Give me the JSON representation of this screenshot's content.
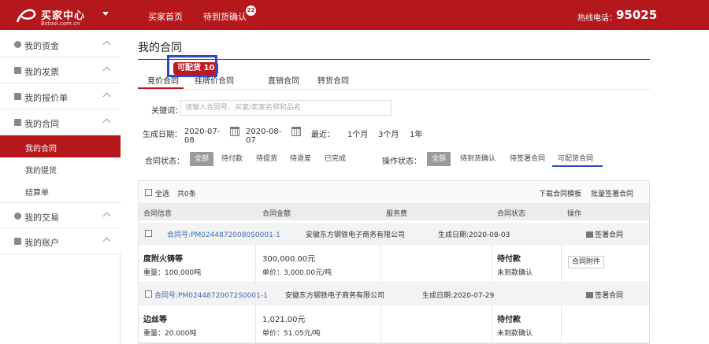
{
  "header": {
    "logo_title": "买家中心",
    "logo_sub": "Bstool.com.cn",
    "nav": [
      {
        "label": "买家首页"
      },
      {
        "label": "待到货确认"
      }
    ],
    "pending_count": "22",
    "hotline_label": "热线电话：",
    "hotline_number": "95025",
    "colors": {
      "brand": "#b5181c"
    }
  },
  "sidebar": {
    "items": [
      {
        "label": "我的资金",
        "icon": "coin-icon"
      },
      {
        "label": "我的发票",
        "icon": "invoice-icon"
      },
      {
        "label": "我的报价单",
        "icon": "quote-icon"
      },
      {
        "label": "我的合同",
        "icon": "contract-icon"
      },
      {
        "label": "我的交易",
        "icon": "trade-icon"
      },
      {
        "label": "我的账户",
        "icon": "account-icon"
      }
    ],
    "subitems": [
      {
        "label": "我的合同",
        "active": true
      },
      {
        "label": "我的提货",
        "active": false
      },
      {
        "label": "结算单",
        "active": false
      }
    ]
  },
  "main": {
    "page_title": "我的合同",
    "tabs": [
      {
        "label": "竞价合同",
        "active": true
      },
      {
        "label": "挂牌价合同",
        "active": false
      },
      {
        "label": "直销合同",
        "active": false
      },
      {
        "label": "转货合同",
        "active": false
      }
    ],
    "tab_badge": "可配货 10",
    "search": {
      "label": "关键词：",
      "placeholder": "请输入合同号、买家/卖家名称和品名"
    },
    "date_filter": {
      "label": "生成日期：",
      "from": "2020-07-08",
      "to": "2020-08-07",
      "recent_label": "最近：",
      "quick": [
        "1个月",
        "3个月",
        "1年"
      ]
    },
    "contract_status": {
      "label": "合同状态：",
      "options": [
        "全部",
        "待付款",
        "待提货",
        "待退差",
        "已完成"
      ],
      "selected": "全部"
    },
    "op_status": {
      "label": "操作状态：",
      "options": [
        "全部",
        "待到货确认",
        "待签署合同",
        "可配货合同"
      ],
      "selected": "全部"
    }
  },
  "table": {
    "select_all": "全选",
    "selected_count": "共0条",
    "download_template": "下载合同模板",
    "batch_sign": "批量签署合同",
    "columns": [
      "合同信息",
      "合同金额",
      "服务费",
      "合同状态",
      "操作"
    ],
    "rows": [
      {
        "contract_no": "合同号:PM02448720080S0001-1",
        "company": "安徽东方钢铁电子商务有限公司",
        "created": "生成日期:2020-08-03",
        "action": "签署合同",
        "product": "度附火铸等",
        "weight": "重量：100.000吨",
        "amount": "300,000.00元",
        "unit_price": "单价：3,000.00元/吨",
        "status": "待付款",
        "sub_status": "未到款确认",
        "button": "合同附件"
      },
      {
        "contract_no": "合同号:PM02448720072S0001-1",
        "company": "安徽东方钢铁电子商务有限公司",
        "created": "生成日期:2020-07-29",
        "action": "签署合同",
        "product": "边丝等",
        "weight": "重量：20.000吨",
        "amount": "1,021.00元",
        "unit_price": "单价：51.05元/吨",
        "status": "待付款",
        "sub_status": "未到款确认",
        "button": ""
      }
    ]
  }
}
